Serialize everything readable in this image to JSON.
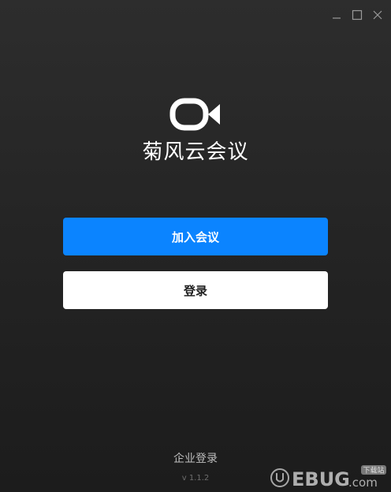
{
  "window": {
    "controls": {
      "minimize_icon": "minimize-icon",
      "maximize_icon": "maximize-icon",
      "close_icon": "close-icon"
    }
  },
  "app": {
    "logo_icon": "video-camera-icon",
    "title": "菊风云会议"
  },
  "actions": {
    "join_label": "加入会议",
    "login_label": "登录"
  },
  "footer": {
    "enterprise_login": "企业登录",
    "version": "v 1.1.2"
  },
  "watermark": {
    "brand": "UEBUG",
    "domain": ".com",
    "tag": "下载站"
  },
  "colors": {
    "background": "#242424",
    "primary": "#0b84ff",
    "secondary": "#ffffff",
    "text_light": "#ffffff",
    "text_muted": "#bdbdbd"
  }
}
